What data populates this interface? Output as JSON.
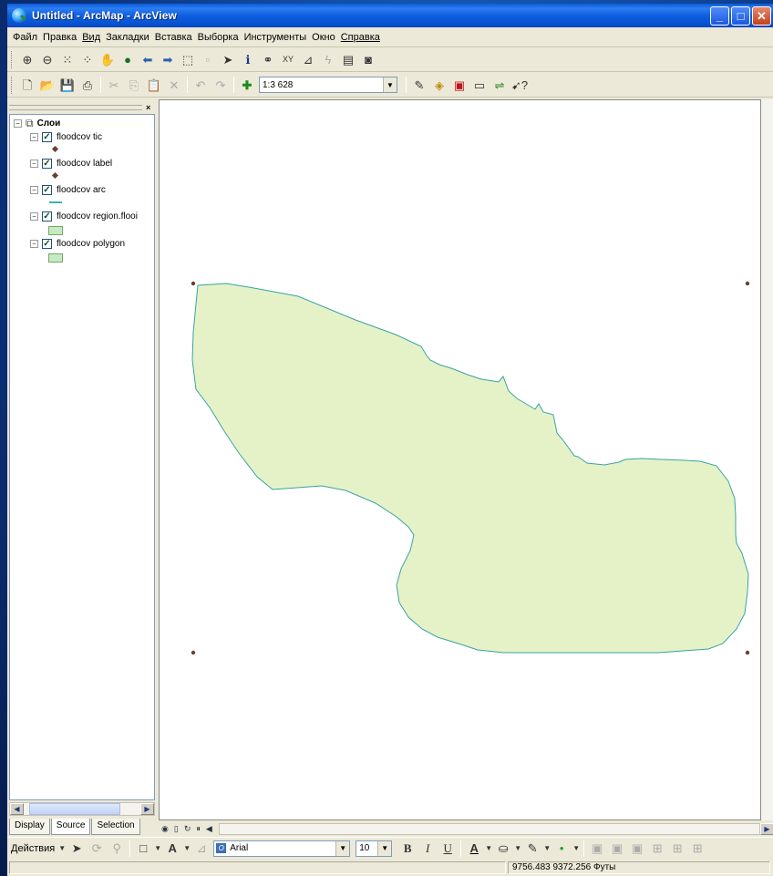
{
  "window": {
    "title": "Untitled - ArcMap - ArcView"
  },
  "menu": [
    "Файл",
    "Правка",
    "Вид",
    "Закладки",
    "Вставка",
    "Выборка",
    "Инструменты",
    "Окно",
    "Справка"
  ],
  "toolbar": {
    "scale_value": "1:3 628"
  },
  "toc": {
    "root_label": "Слои",
    "layers": [
      {
        "label": "floodcov tic",
        "symbol": "point"
      },
      {
        "label": "floodcov label",
        "symbol": "point"
      },
      {
        "label": "floodcov arc",
        "symbol": "line"
      },
      {
        "label": "floodcov region.flooi",
        "symbol": "polygon"
      },
      {
        "label": "floodcov polygon",
        "symbol": "polygon"
      }
    ],
    "tabs": [
      "Display",
      "Source",
      "Selection"
    ]
  },
  "drawing": {
    "actions_label": "Действия",
    "font_name": "Arial",
    "font_size": "10"
  },
  "status": {
    "coordinates": "9756.483  9372.256 Футы"
  },
  "colors": {
    "polygon_fill": "#e5f2c7",
    "polygon_outline": "#3aa3a3",
    "tic_point": "#6b3f2a"
  }
}
